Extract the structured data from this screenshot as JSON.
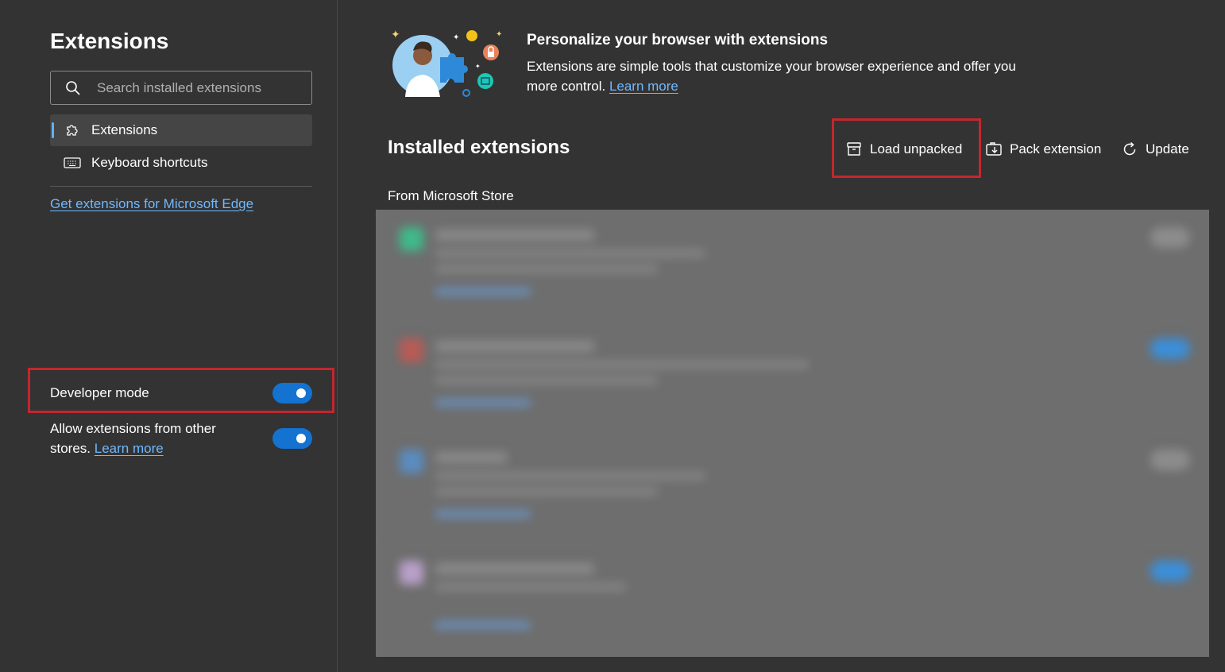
{
  "sidebar": {
    "title": "Extensions",
    "search": {
      "placeholder": "Search installed extensions",
      "value": ""
    },
    "nav": [
      {
        "label": "Extensions",
        "icon": "puzzle-icon",
        "active": true
      },
      {
        "label": "Keyboard shortcuts",
        "icon": "keyboard-icon",
        "active": false
      }
    ],
    "get_extensions_link": "Get extensions for Microsoft Edge",
    "developer_mode": {
      "label": "Developer mode",
      "enabled": true
    },
    "allow_other_stores": {
      "label": "Allow extensions from other stores.",
      "link": "Learn more",
      "enabled": true
    }
  },
  "main": {
    "hero": {
      "title": "Personalize your browser with extensions",
      "description": "Extensions are simple tools that customize your browser experience and offer you more control.",
      "link": "Learn more"
    },
    "installed_title": "Installed extensions",
    "actions": [
      {
        "label": "Load unpacked",
        "icon": "box-icon"
      },
      {
        "label": "Pack extension",
        "icon": "pack-icon"
      },
      {
        "label": "Update",
        "icon": "refresh-icon"
      }
    ],
    "from_store_label": "From Microsoft Store"
  },
  "colors": {
    "accent": "#1472d0",
    "link": "#70b8ff",
    "highlight": "#c4262e",
    "background": "#333333"
  }
}
